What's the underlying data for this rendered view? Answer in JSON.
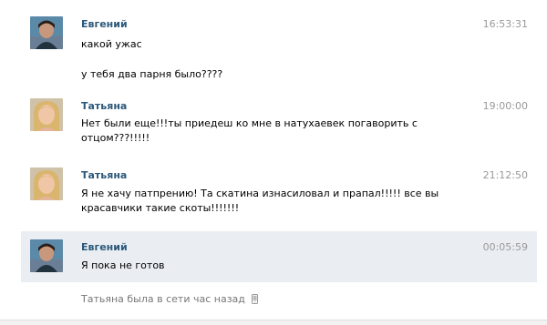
{
  "messages": [
    {
      "author": "Евгений",
      "time": "16:53:31",
      "lines": [
        "какой ужас",
        "у тебя два парня было????"
      ]
    },
    {
      "author": "Татьяна",
      "time": "19:00:00",
      "lines": [
        "Нет были еще!!!ты приедеш ко мне в натухаевек погаворить с отцом???!!!!!"
      ]
    },
    {
      "author": "Татьяна",
      "time": "21:12:50",
      "lines": [
        "Я не хачу патпрению! Та скатина изнасиловал и прапал!!!!! все вы красавчики такие скоты!!!!!!!"
      ]
    },
    {
      "author": "Евгений",
      "time": "00:05:59",
      "lines": [
        "Я пока не готов"
      ]
    }
  ],
  "status": {
    "text": "Татьяна была в сети час назад",
    "icon": "mobile-phone-icon"
  },
  "colors": {
    "author": "#2b587a",
    "time": "#999999",
    "highlight_bg": "#eaeef3",
    "status": "#777777"
  }
}
